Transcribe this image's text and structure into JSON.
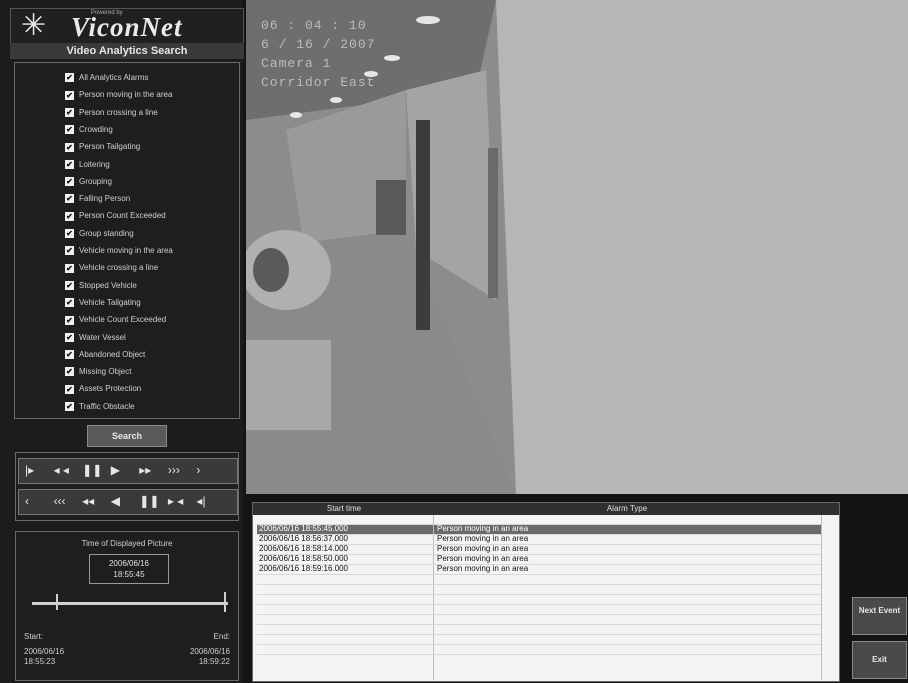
{
  "logo": {
    "brand": "ViconNet",
    "powered": "Powered by",
    "mark": "✳"
  },
  "left": {
    "title": "Video Analytics Search",
    "checkboxes": [
      "All Analytics Alarms",
      "Person moving in the area",
      "Person crossing a line",
      "Crowding",
      "Person Tailgating",
      "Loitering",
      "Grouping",
      "Falling Person",
      "Person Count Exceeded",
      "Group standing",
      "Vehicle moving in the area",
      "Vehicle crossing a line",
      "Stopped Vehicle",
      "Vehicle Tailgating",
      "Vehicle Count Exceeded",
      "Water Vessel",
      "Abandoned Object",
      "Missing Object",
      "Assets Protection",
      "Traffic Obstacle"
    ],
    "search_label": "Search"
  },
  "controls": {
    "row1": [
      "|▸",
      "◂ ◂",
      "❚❚",
      "▶",
      "▸▸",
      "›››",
      "›"
    ],
    "row2": [
      "‹",
      "‹‹‹",
      "◂◂",
      "◀",
      "❚❚",
      "▸ ◂",
      "◂|"
    ]
  },
  "time": {
    "label": "Time of Displayed Picture",
    "current_date": "2006/06/16",
    "current_time": "18:55:45",
    "start_label": "Start:",
    "start_date": "2006/06/16",
    "start_time": "18:55:23",
    "end_label": "End:",
    "end_date": "2006/06/16",
    "end_time": "18:59:22",
    "slider_position_pct": 12
  },
  "video": {
    "overlay_lines": [
      "06 : 04 : 10",
      "6 / 16 / 2007",
      "Camera 1",
      "Corridor East"
    ]
  },
  "table": {
    "headers": [
      "Start time",
      "Alarm Type"
    ],
    "rows": [
      {
        "start": "2006/06/16 18:55:45.000",
        "type": "Person moving in an area"
      },
      {
        "start": "2006/06/16 18:56:37.000",
        "type": "Person moving in an area"
      },
      {
        "start": "2006/06/16 18:58:14.000",
        "type": "Person moving in an area"
      },
      {
        "start": "2006/06/16 18:58:50.000",
        "type": "Person moving in an area"
      },
      {
        "start": "2006/06/16 18:59:16.000",
        "type": "Person moving in an area"
      }
    ]
  },
  "buttons": {
    "next_event": "Next Event",
    "exit": "Exit"
  }
}
